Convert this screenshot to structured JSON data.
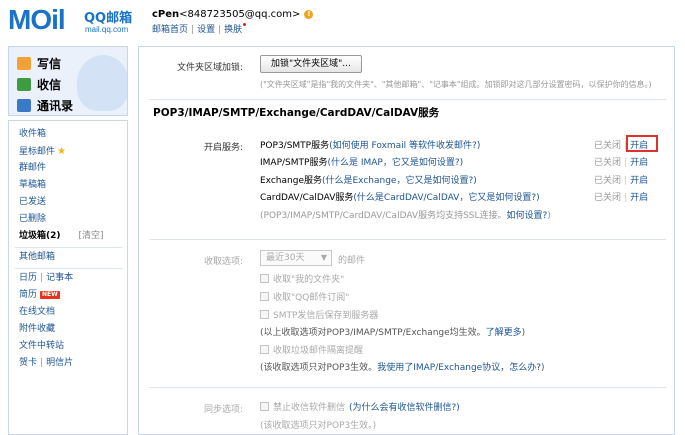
{
  "header": {
    "logo_text": "MOil",
    "logo_cn": "QQ邮箱",
    "logo_domain": "mail.qq.com",
    "user_name": "cPen",
    "user_email": "<848723505@qq.com>",
    "warn_symbol": "!",
    "link_home": "邮箱首页",
    "link_settings": "设置",
    "link_skin": "换肤",
    "sep": "|"
  },
  "sidebar": {
    "quick": {
      "write": "写信",
      "inbox": "收信",
      "contacts": "通讯录"
    },
    "items": [
      {
        "label": "收件箱"
      },
      {
        "label": "星标邮件"
      },
      {
        "label": "群邮件"
      },
      {
        "label": "草稿箱"
      },
      {
        "label": "已发送"
      },
      {
        "label": "已删除"
      },
      {
        "label": "垃圾箱(2)",
        "extra": "[清空]"
      },
      {
        "label": "其他邮箱"
      },
      {
        "label": "日历",
        "extra": "记事本"
      },
      {
        "label": "简历",
        "badge": "NEW"
      },
      {
        "label": "在线文档"
      },
      {
        "label": "附件收藏"
      },
      {
        "label": "文件中转站"
      },
      {
        "label": "贺卡",
        "extra": "明信片"
      }
    ]
  },
  "main": {
    "folder_lock": {
      "label": "文件夹区域加锁:",
      "button": "加锁\"文件夹区域\"...",
      "note": "(\"文件夹区域\"是指\"我的文件夹\"、\"其他邮箱\"、\"记事本\"组成。加锁即对这几部分设置密码，以保护你的信息。)"
    },
    "section_title": "POP3/IMAP/SMTP/Exchange/CardDAV/CalDAV服务",
    "services": {
      "label": "开启服务:",
      "rows": [
        {
          "name": "POP3/SMTP服务",
          "help": "(如何使用 Foxmail 等软件收发邮件?)",
          "status": "已关闭",
          "action": "开启"
        },
        {
          "name": "IMAP/SMTP服务",
          "help": "(什么是 IMAP，它又是如何设置?)",
          "status": "已关闭",
          "action": "开启"
        },
        {
          "name": "Exchange服务",
          "help": "(什么是Exchange，它又是如何设置?)",
          "status": "已关闭",
          "action": "开启"
        },
        {
          "name": "CardDAV/CalDAV服务",
          "help": "(什么是CardDAV/CalDAV，它又是如何设置?)",
          "status": "已关闭",
          "action": "开启"
        }
      ],
      "ssl_note_prefix": "(POP3/IMAP/SMTP/CardDAV/CalDAV服务均支持SSL连接。",
      "ssl_note_link": "如何设置?",
      "ssl_note_suffix": ")"
    },
    "receive": {
      "label": "收取选项:",
      "select_value": "最近30天",
      "select_suffix": "的邮件",
      "opt1": "收取\"我的文件夹\"",
      "opt2": "收取\"QQ邮件订阅\"",
      "opt3": "SMTP发信后保存到服务器",
      "note1_prefix": "(以上收取选项对POP3/IMAP/SMTP/Exchange均生效。",
      "note1_link": "了解更多",
      "note1_suffix": ")",
      "opt4": "收取垃圾邮件隔离提醒",
      "note2_prefix": "(该收取选项只对POP3生效。",
      "note2_link": "我使用了IMAP/Exchange协议，怎么办?",
      "note2_suffix": ")"
    },
    "sync": {
      "label": "同步选项:",
      "opt1": "禁止收信软件删信",
      "opt1_link": "(为什么会有收信软件删信?)",
      "note": "(该收取选项只对POP3生效。)"
    }
  },
  "colors": {
    "brand_blue": "#1a73c8",
    "link_blue": "#1e5494",
    "highlight_red": "#e03030",
    "warn_orange": "#f2a51a"
  }
}
